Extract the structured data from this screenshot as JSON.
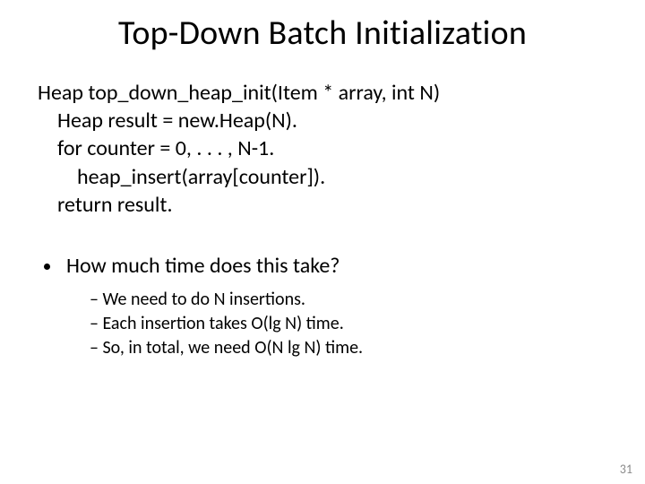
{
  "title": "Top-Down Batch Initialization",
  "pseudocode": {
    "l0": "Heap top_down_heap_init(Item * array, int N)",
    "l1": "Heap result = new.Heap(N).",
    "l2": "for counter = 0, . . . , N-1.",
    "l3": "heap_insert(array[counter]).",
    "l4": "return result."
  },
  "question": "How much time does this take?",
  "answers": {
    "a0": "We need to do N insertions.",
    "a1": "Each insertion takes O(lg N) time.",
    "a2": "So, in total, we need O(N lg N) time."
  },
  "page_number": "31"
}
